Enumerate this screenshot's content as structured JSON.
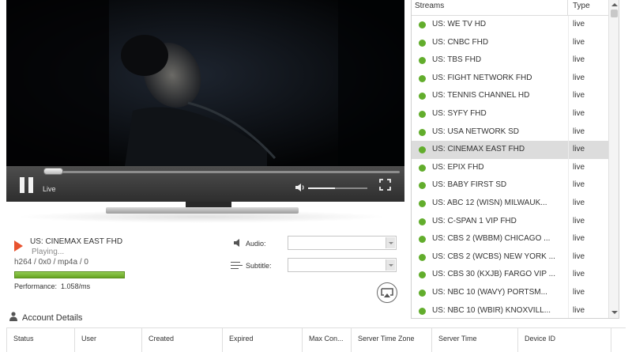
{
  "player": {
    "live_label": "Live",
    "volume_level": 0.45,
    "seek_position": 0.0
  },
  "now_playing": {
    "title": "US: CINEMAX EAST FHD",
    "status": "Playing...",
    "codec": "h264 / 0x0 / mp4a / 0",
    "performance_label": "Performance:",
    "performance_value": "1.058/ms",
    "buffer_fill": 1.0
  },
  "audio": {
    "label": "Audio:",
    "selected": ""
  },
  "subtitle": {
    "label": "Subtitle:",
    "selected": ""
  },
  "account": {
    "title": "Account Details",
    "columns": [
      "Status",
      "User",
      "Created",
      "Expired",
      "Max Con...",
      "Server Time Zone",
      "Server Time",
      "Device ID"
    ]
  },
  "streams": {
    "header_name": "Streams",
    "header_type": "Type",
    "selected_index": 7,
    "items": [
      {
        "name": "US: WE TV HD",
        "type": "live"
      },
      {
        "name": "US: CNBC FHD",
        "type": "live"
      },
      {
        "name": "US: TBS FHD",
        "type": "live"
      },
      {
        "name": "US: FIGHT NETWORK FHD",
        "type": "live"
      },
      {
        "name": "US: TENNIS CHANNEL HD",
        "type": "live"
      },
      {
        "name": "US: SYFY FHD",
        "type": "live"
      },
      {
        "name": "US: USA NETWORK SD",
        "type": "live"
      },
      {
        "name": "US: CINEMAX EAST FHD",
        "type": "live"
      },
      {
        "name": "US: EPIX FHD",
        "type": "live"
      },
      {
        "name": "US: BABY FIRST SD",
        "type": "live"
      },
      {
        "name": "US: ABC 12 (WISN) MILWAUK...",
        "type": "live"
      },
      {
        "name": "US: C-SPAN 1 VIP FHD",
        "type": "live"
      },
      {
        "name": "US: CBS 2 (WBBM) CHICAGO ...",
        "type": "live"
      },
      {
        "name": "US: CBS 2 (WCBS) NEW YORK ...",
        "type": "live"
      },
      {
        "name": "US: CBS 30 (KXJB) FARGO VIP ...",
        "type": "live"
      },
      {
        "name": "US: NBC 10 (WAVY) PORTSM...",
        "type": "live"
      },
      {
        "name": "US: NBC 10 (WBIR) KNOXVILL...",
        "type": "live"
      }
    ]
  },
  "colors": {
    "live_dot": "#62ad2c",
    "play_indicator": "#e8532f",
    "performance_bar": "#6aa924",
    "selected_row": "#dcdcdc"
  },
  "icons": [
    "pause-icon",
    "volume-icon",
    "fullscreen-icon",
    "play-icon",
    "speaker-icon",
    "subtitle-icon",
    "cast-icon",
    "user-icon",
    "chevron-up-icon",
    "chevron-down-icon"
  ]
}
